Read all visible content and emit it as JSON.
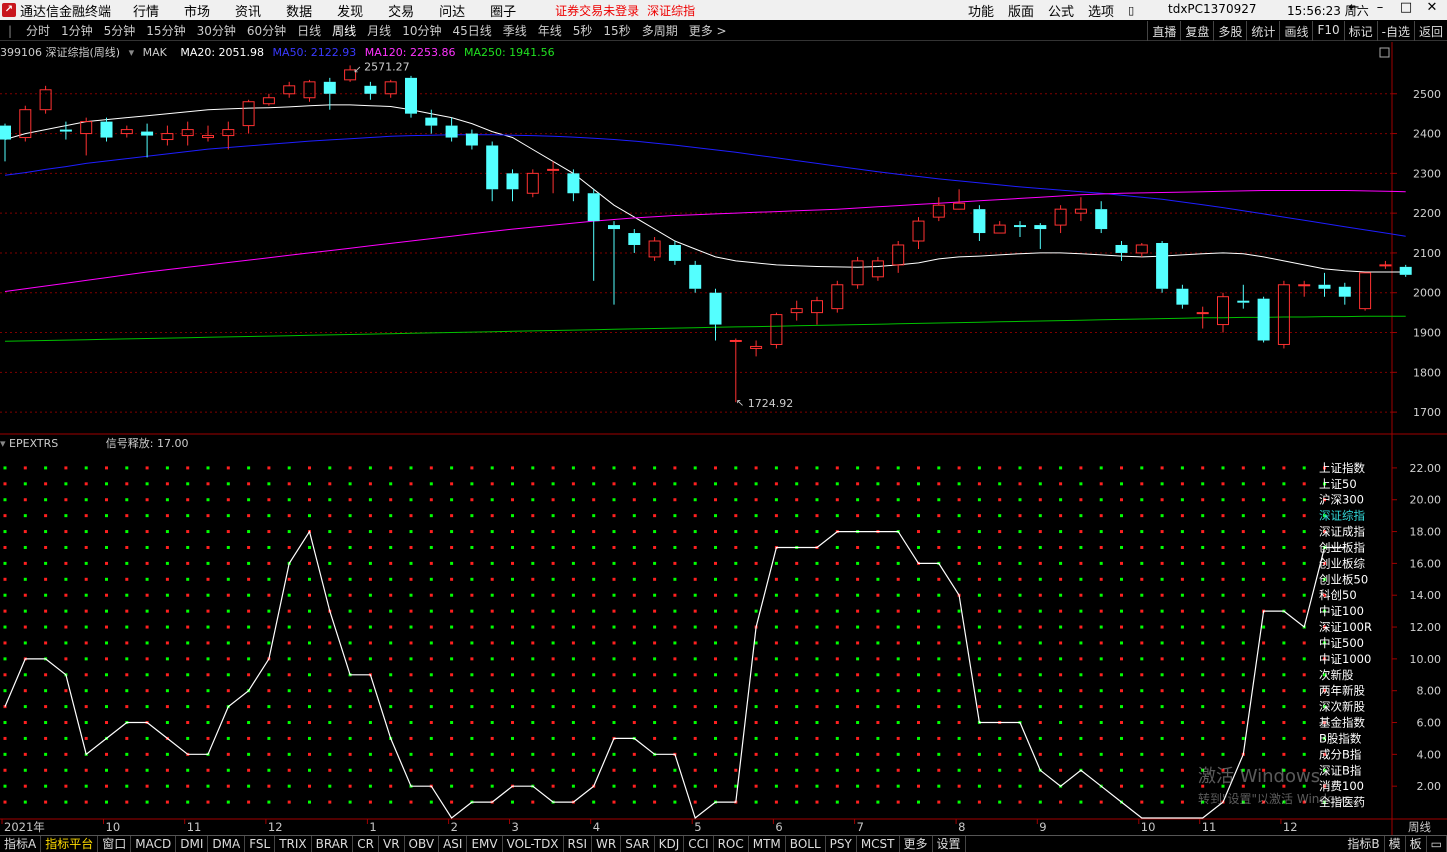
{
  "menubar": {
    "app_name": "通达信金融终端",
    "menus": [
      "行情",
      "市场",
      "资讯",
      "数据",
      "发现",
      "交易",
      "问达",
      "圈子"
    ],
    "alert": "证券交易未登录",
    "alert_index": "深证综指",
    "right_menus": [
      "功能",
      "版面",
      "公式",
      "选项"
    ],
    "pc_id": "tdxPC1370927",
    "clock": "15:56:23 周六",
    "window_buttons": [
      "←",
      "–",
      "□",
      "✕"
    ]
  },
  "periodbar": {
    "periods": [
      "分时",
      "1分钟",
      "5分钟",
      "15分钟",
      "30分钟",
      "60分钟",
      "日线",
      "周线",
      "月线",
      "10分钟",
      "45日线",
      "季线",
      "年线",
      "5秒",
      "15秒",
      "多周期",
      "更多 >"
    ],
    "active": "周线",
    "tools": [
      "直播",
      "复盘",
      "多股",
      "统计",
      "画线",
      "F10",
      "标记",
      "-自选",
      "返回"
    ]
  },
  "infobar": {
    "symbol": "399106 深证综指(周线)",
    "mak": "MAK",
    "ma20": "MA20: 2051.98",
    "ma50": "MA50: 2122.93",
    "ma120": "MA120: 2253.86",
    "ma250": "MA250: 1941.56"
  },
  "colors": {
    "up": "#ff3232",
    "down": "#54ffff",
    "ma20": "#ffffff",
    "ma50": "#1e1eff",
    "ma120": "#ff00ff",
    "ma250": "#00c000",
    "axis": "#a00000",
    "dot_red": "#ff2020",
    "dot_green": "#00ff00"
  },
  "price_axis": {
    "ticks": [
      "2500",
      "2400",
      "2300",
      "2200",
      "2100",
      "2000",
      "1900",
      "1800",
      "1700"
    ],
    "range": [
      1650,
      2610
    ]
  },
  "annotations": {
    "high": "2571.27",
    "low": "1724.92"
  },
  "indicator": {
    "name": "EPEXTRS",
    "signal": "信号释放: 17.00",
    "ticks": [
      "22.00",
      "20.00",
      "18.00",
      "16.00",
      "14.00",
      "12.00",
      "10.00",
      "8.00",
      "6.00",
      "4.00",
      "2.00"
    ],
    "range": [
      0,
      23
    ],
    "names": [
      "上证指数",
      "上证50",
      "沪深300",
      "深证综指",
      "深证成指",
      "创业板指",
      "创业板综",
      "创业板50",
      "科创50",
      "中证100",
      "深证100R",
      "中证500",
      "中证1000",
      "次新股",
      "两年新股",
      "深次新股",
      "基金指数",
      "B股指数",
      "成分B指",
      "深证B指",
      "消费100",
      "全指医药"
    ],
    "highlight": "深证综指",
    "values": [
      7,
      10,
      10,
      9,
      4,
      5,
      6,
      6,
      5,
      4,
      4,
      7,
      8,
      10,
      16,
      18,
      13,
      9,
      9,
      5,
      2,
      2,
      0,
      1,
      1,
      2,
      2,
      1,
      1,
      2,
      5,
      5,
      4,
      4,
      0,
      1,
      1,
      12,
      17,
      17,
      17,
      18,
      18,
      18,
      18,
      16,
      16,
      14,
      6,
      6,
      6,
      3,
      2,
      3,
      2,
      1,
      0,
      0,
      0,
      0,
      1,
      4,
      13,
      13,
      12,
      17,
      17
    ]
  },
  "time_axis": {
    "labels": [
      {
        "i": 0,
        "t": "2021年"
      },
      {
        "i": 5,
        "t": "10"
      },
      {
        "i": 9,
        "t": "11"
      },
      {
        "i": 13,
        "t": "12"
      },
      {
        "i": 18,
        "t": "1"
      },
      {
        "i": 22,
        "t": "2"
      },
      {
        "i": 25,
        "t": "3"
      },
      {
        "i": 29,
        "t": "4"
      },
      {
        "i": 34,
        "t": "5"
      },
      {
        "i": 38,
        "t": "6"
      },
      {
        "i": 42,
        "t": "7"
      },
      {
        "i": 47,
        "t": "8"
      },
      {
        "i": 51,
        "t": "9"
      },
      {
        "i": 56,
        "t": "10"
      },
      {
        "i": 59,
        "t": "11"
      },
      {
        "i": 63,
        "t": "12"
      }
    ],
    "period_label": "周线"
  },
  "chart_data": {
    "type": "candlestick",
    "title": "399106 深证综指(周线)",
    "candles": [
      [
        2420,
        2385,
        2425,
        2330
      ],
      [
        2390,
        2460,
        2470,
        2380
      ],
      [
        2460,
        2510,
        2520,
        2450
      ],
      [
        2410,
        2405,
        2430,
        2385
      ],
      [
        2400,
        2430,
        2440,
        2345
      ],
      [
        2430,
        2390,
        2440,
        2380
      ],
      [
        2400,
        2410,
        2420,
        2390
      ],
      [
        2405,
        2395,
        2425,
        2340
      ],
      [
        2385,
        2400,
        2420,
        2370
      ],
      [
        2395,
        2410,
        2430,
        2370
      ],
      [
        2390,
        2395,
        2420,
        2380
      ],
      [
        2395,
        2410,
        2430,
        2360
      ],
      [
        2420,
        2480,
        2485,
        2400
      ],
      [
        2475,
        2490,
        2500,
        2470
      ],
      [
        2500,
        2520,
        2530,
        2490
      ],
      [
        2490,
        2530,
        2535,
        2480
      ],
      [
        2530,
        2500,
        2540,
        2460
      ],
      [
        2535,
        2560,
        2571.27,
        2530
      ],
      [
        2520,
        2500,
        2530,
        2485
      ],
      [
        2500,
        2530,
        2535,
        2490
      ],
      [
        2540,
        2450,
        2545,
        2440
      ],
      [
        2440,
        2420,
        2460,
        2400
      ],
      [
        2420,
        2390,
        2440,
        2380
      ],
      [
        2400,
        2370,
        2410,
        2360
      ],
      [
        2370,
        2260,
        2380,
        2230
      ],
      [
        2300,
        2260,
        2310,
        2230
      ],
      [
        2250,
        2300,
        2310,
        2240
      ],
      [
        2310,
        2310,
        2330,
        2250
      ],
      [
        2300,
        2250,
        2310,
        2230
      ],
      [
        2250,
        2180,
        2260,
        2030
      ],
      [
        2170,
        2160,
        2180,
        1970
      ],
      [
        2150,
        2120,
        2160,
        2100
      ],
      [
        2090,
        2130,
        2140,
        2080
      ],
      [
        2120,
        2080,
        2130,
        2070
      ],
      [
        2070,
        2010,
        2080,
        2000
      ],
      [
        2000,
        1920,
        2010,
        1880
      ],
      [
        1880,
        1880,
        1885,
        1724.92
      ],
      [
        1860,
        1865,
        1880,
        1840
      ],
      [
        1870,
        1945,
        1950,
        1860
      ],
      [
        1950,
        1960,
        1980,
        1930
      ],
      [
        1950,
        1980,
        1990,
        1920
      ],
      [
        1960,
        2020,
        2030,
        1950
      ],
      [
        2020,
        2080,
        2090,
        2010
      ],
      [
        2040,
        2080,
        2090,
        2030
      ],
      [
        2070,
        2120,
        2130,
        2050
      ],
      [
        2130,
        2180,
        2190,
        2110
      ],
      [
        2190,
        2220,
        2240,
        2180
      ],
      [
        2210,
        2225,
        2260,
        2210
      ],
      [
        2210,
        2150,
        2220,
        2130
      ],
      [
        2150,
        2170,
        2180,
        2150
      ],
      [
        2170,
        2165,
        2180,
        2140
      ],
      [
        2170,
        2160,
        2175,
        2110
      ],
      [
        2170,
        2210,
        2220,
        2150
      ],
      [
        2200,
        2210,
        2240,
        2180
      ],
      [
        2210,
        2160,
        2230,
        2150
      ],
      [
        2120,
        2100,
        2130,
        2080
      ],
      [
        2100,
        2120,
        2125,
        2090
      ],
      [
        2125,
        2010,
        2130,
        2000
      ],
      [
        2010,
        1970,
        2020,
        1960
      ],
      [
        1950,
        1950,
        1965,
        1910
      ],
      [
        1920,
        1990,
        2000,
        1900
      ],
      [
        1980,
        1975,
        2020,
        1960
      ],
      [
        1985,
        1880,
        1990,
        1875
      ],
      [
        1870,
        2020,
        2030,
        1860
      ],
      [
        2020,
        2020,
        2030,
        1990
      ],
      [
        2020,
        2010,
        2050,
        1990
      ],
      [
        2015,
        1990,
        2025,
        1970
      ],
      [
        1960,
        2050,
        2050,
        1955
      ],
      [
        2070,
        2070,
        2080,
        2060
      ],
      [
        2065,
        2045,
        2070,
        2040
      ]
    ],
    "ylim": [
      1650,
      2610
    ],
    "series": [
      {
        "name": "MA20",
        "values": [
          2385,
          2400,
          2410,
          2420,
          2430,
          2435,
          2440,
          2445,
          2450,
          2455,
          2460,
          2462,
          2464,
          2465,
          2467,
          2470,
          2472,
          2472,
          2470,
          2468,
          2460,
          2450,
          2440,
          2425,
          2405,
          2390,
          2360,
          2330,
          2300,
          2260,
          2220,
          2190,
          2160,
          2130,
          2110,
          2090,
          2080,
          2075,
          2070,
          2068,
          2066,
          2065,
          2064,
          2066,
          2070,
          2075,
          2085,
          2090,
          2092,
          2095,
          2098,
          2100,
          2100,
          2098,
          2095,
          2092,
          2090,
          2092,
          2095,
          2098,
          2100,
          2098,
          2090,
          2080,
          2070,
          2060,
          2055,
          2052,
          2052,
          2052
        ]
      },
      {
        "name": "MA50",
        "values": [
          2295,
          2302,
          2310,
          2317,
          2325,
          2331,
          2337,
          2343,
          2349,
          2355,
          2361,
          2365,
          2369,
          2373,
          2377,
          2381,
          2384,
          2387,
          2390,
          2393,
          2395,
          2396,
          2397,
          2397,
          2397,
          2396,
          2395,
          2393,
          2391,
          2388,
          2385,
          2381,
          2376,
          2371,
          2365,
          2359,
          2353,
          2346,
          2339,
          2332,
          2325,
          2318,
          2311,
          2304,
          2298,
          2292,
          2286,
          2281,
          2276,
          2271,
          2266,
          2262,
          2258,
          2254,
          2250,
          2245,
          2240,
          2235,
          2228,
          2221,
          2214,
          2206,
          2198,
          2190,
          2182,
          2174,
          2166,
          2158,
          2150,
          2142
        ]
      },
      {
        "name": "MA120",
        "values": [
          2003,
          2010,
          2017,
          2024,
          2031,
          2038,
          2045,
          2052,
          2058,
          2064,
          2070,
          2076,
          2082,
          2088,
          2094,
          2100,
          2106,
          2112,
          2118,
          2124,
          2130,
          2136,
          2142,
          2148,
          2154,
          2160,
          2165,
          2170,
          2175,
          2180,
          2184,
          2188,
          2191,
          2194,
          2196,
          2198,
          2200,
          2202,
          2204,
          2206,
          2208,
          2210,
          2213,
          2216,
          2219,
          2222,
          2225,
          2228,
          2231,
          2234,
          2237,
          2240,
          2243,
          2246,
          2248,
          2250,
          2251,
          2252,
          2253,
          2254,
          2255,
          2256,
          2257,
          2257,
          2257,
          2257,
          2257,
          2256,
          2255,
          2254
        ]
      },
      {
        "name": "MA250",
        "values": [
          1878,
          1879,
          1880,
          1881,
          1882,
          1883,
          1884,
          1885,
          1886,
          1887,
          1888,
          1889,
          1890,
          1891,
          1892,
          1893,
          1894,
          1895,
          1896,
          1897,
          1898,
          1899,
          1900,
          1901,
          1902,
          1903,
          1904,
          1905,
          1906,
          1907,
          1908,
          1909,
          1910,
          1911,
          1912,
          1913,
          1914,
          1915,
          1916,
          1917,
          1918,
          1919,
          1920,
          1921,
          1922,
          1923,
          1924,
          1925,
          1926,
          1927,
          1928,
          1929,
          1930,
          1931,
          1932,
          1933,
          1934,
          1935,
          1936,
          1937,
          1937,
          1938,
          1938,
          1939,
          1939,
          1940,
          1940,
          1941,
          1941,
          1941
        ]
      }
    ]
  },
  "bottombar": {
    "tabs": [
      "指标A",
      "指标平台",
      "窗口",
      "MACD",
      "DMI",
      "DMA",
      "FSL",
      "TRIX",
      "BRAR",
      "CR",
      "VR",
      "OBV",
      "ASI",
      "EMV",
      "VOL-TDX",
      "RSI",
      "WR",
      "SAR",
      "KDJ",
      "CCI",
      "ROC",
      "MTM",
      "BOLL",
      "PSY",
      "MCST",
      "更多",
      "设置"
    ],
    "active": "指标平台",
    "right_tabs": [
      "指标B",
      "模",
      "板"
    ]
  },
  "watermark": {
    "line1": "激活 Windows",
    "line2": "转到\"设置\"以激活 Windows。"
  }
}
